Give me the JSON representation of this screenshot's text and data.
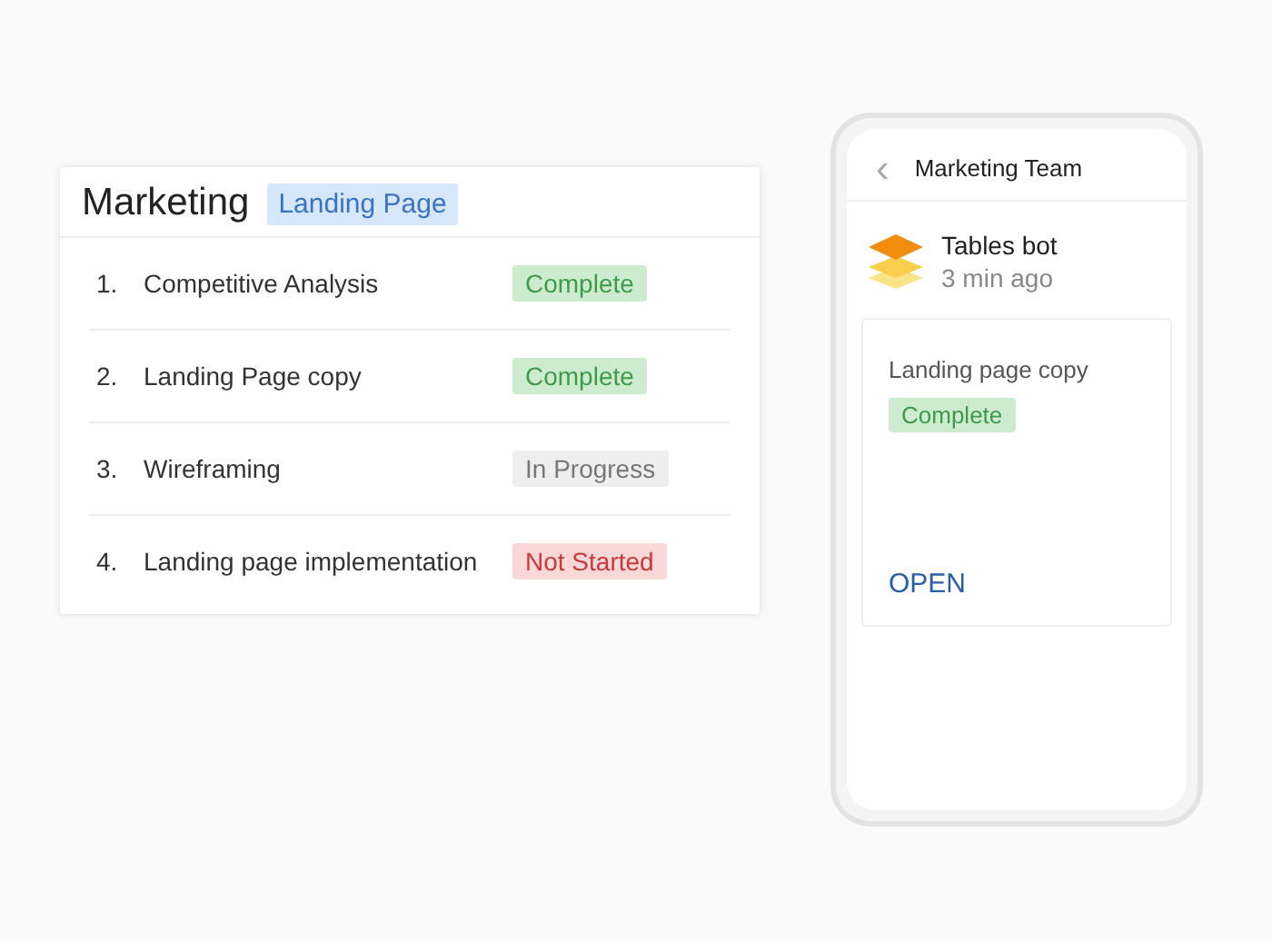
{
  "task_list": {
    "title": "Marketing",
    "tag": "Landing Page",
    "rows": [
      {
        "number": "1.",
        "name": "Competitive Analysis",
        "status": {
          "label": "Complete",
          "kind": "complete"
        }
      },
      {
        "number": "2.",
        "name": "Landing Page copy",
        "status": {
          "label": "Complete",
          "kind": "complete"
        }
      },
      {
        "number": "3.",
        "name": "Wireframing",
        "status": {
          "label": "In Progress",
          "kind": "progress"
        }
      },
      {
        "number": "4.",
        "name": "Landing page implementation",
        "status": {
          "label": "Not Started",
          "kind": "notstarted"
        }
      }
    ]
  },
  "phone": {
    "title": "Marketing Team",
    "back": "‹",
    "message": {
      "sender": "Tables bot",
      "time": "3 min ago",
      "card": {
        "title": "Landing page copy",
        "status": {
          "label": "Complete",
          "kind": "complete"
        },
        "action": "OPEN"
      }
    }
  }
}
